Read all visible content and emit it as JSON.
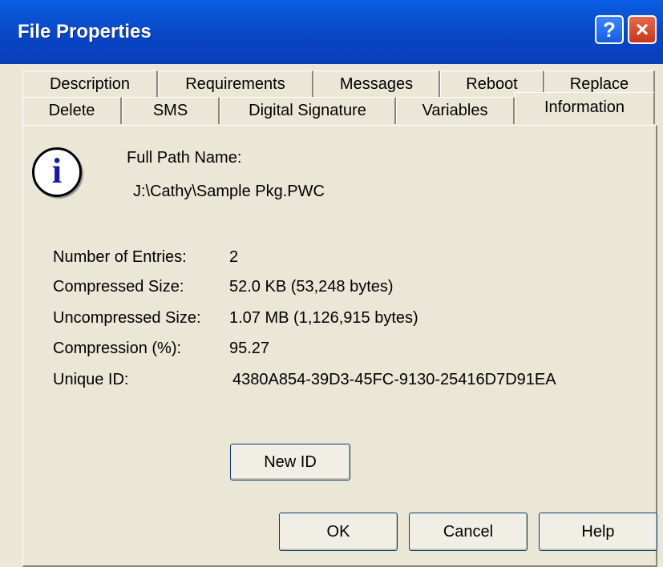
{
  "window": {
    "title": "File Properties"
  },
  "title_buttons": {
    "help": "?",
    "close": "×"
  },
  "tabs_row1": [
    "Description",
    "Requirements",
    "Messages",
    "Reboot",
    "Replace"
  ],
  "tabs_row2": [
    "Delete",
    "SMS",
    "Digital Signature",
    "Variables",
    "Information"
  ],
  "active_tab": "Information",
  "info": {
    "icon": "info-icon",
    "full_path_label": "Full Path Name:",
    "full_path_value": "J:\\Cathy\\Sample Pkg.PWC",
    "entries_label": "Number of Entries:",
    "entries_value": "2",
    "compressed_label": "Compressed Size:",
    "compressed_value": "52.0 KB (53,248 bytes)",
    "uncompressed_label": "Uncompressed Size:",
    "uncompressed_value": "1.07 MB (1,126,915 bytes)",
    "compression_label": "Compression (%):",
    "compression_value": "95.27",
    "unique_id_label": "Unique ID:",
    "unique_id_value": "4380A854-39D3-45FC-9130-25416D7D91EA",
    "new_id_button": "New ID"
  },
  "footer": {
    "ok": "OK",
    "cancel": "Cancel",
    "help": "Help"
  }
}
